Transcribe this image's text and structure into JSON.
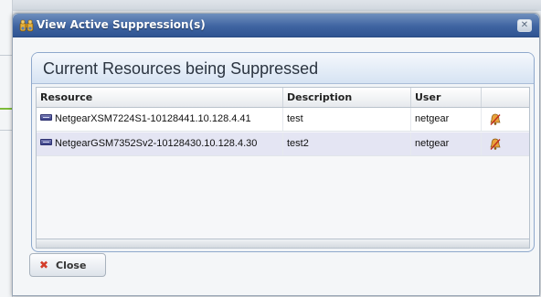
{
  "dialog": {
    "title": "View Active Suppression(s)",
    "close_glyph": "✕",
    "title_icon": "binoculars-icon"
  },
  "panel": {
    "title": "Current Resources being Suppressed"
  },
  "table": {
    "columns": [
      "Resource",
      "Description",
      "User",
      ""
    ],
    "rows": [
      {
        "resource": "NetgearXSM7224S1-10128441.10.128.4.41",
        "description": "test",
        "user": "netgear",
        "icon": "suppression-bell-icon"
      },
      {
        "resource": "NetgearGSM7352Sv2-10128430.10.128.4.30",
        "description": "test2",
        "user": "netgear",
        "icon": "suppression-bell-icon"
      }
    ]
  },
  "buttons": {
    "close_label": "Close"
  },
  "colors": {
    "titlebar": "#3f64a1",
    "selected_row": "#e4e5f3",
    "close_x": "#d33c2a"
  }
}
